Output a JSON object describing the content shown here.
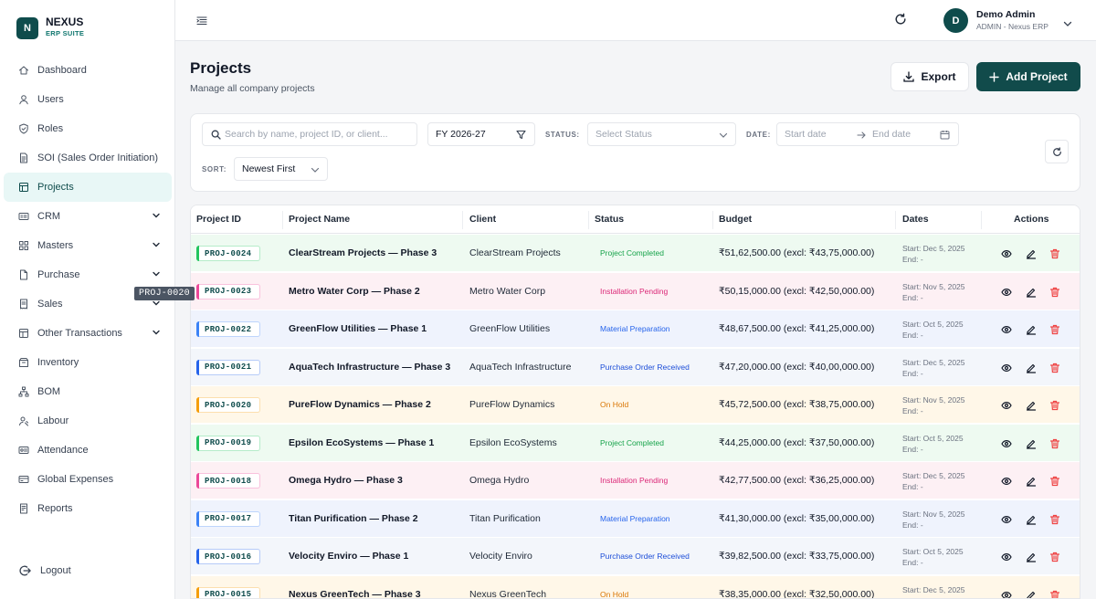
{
  "brand": {
    "logo": "N",
    "name": "NEXUS",
    "sub": "ERP SUITE"
  },
  "sidebar": {
    "items": [
      {
        "label": "Dashboard",
        "icon": "home-icon"
      },
      {
        "label": "Users",
        "icon": "user-icon"
      },
      {
        "label": "Roles",
        "icon": "shield-icon"
      },
      {
        "label": "SOI (Sales Order Initiation)",
        "icon": "document-icon"
      },
      {
        "label": "Projects",
        "icon": "grid-icon",
        "active": true
      },
      {
        "label": "CRM",
        "icon": "crm-icon",
        "expandable": true
      },
      {
        "label": "Masters",
        "icon": "apps-icon",
        "expandable": true
      },
      {
        "label": "Purchase",
        "icon": "file-icon",
        "expandable": true
      },
      {
        "label": "Sales",
        "icon": "receipt-icon",
        "expandable": true
      },
      {
        "label": "Other Transactions",
        "icon": "layout-icon",
        "expandable": true
      },
      {
        "label": "Inventory",
        "icon": "box-icon"
      },
      {
        "label": "BOM",
        "icon": "tree-icon"
      },
      {
        "label": "Labour",
        "icon": "worker-icon"
      },
      {
        "label": "Attendance",
        "icon": "id-card-icon"
      },
      {
        "label": "Global Expenses",
        "icon": "wallet-icon"
      },
      {
        "label": "Reports",
        "icon": "report-icon"
      }
    ],
    "logout": "Logout",
    "tooltip": "PROJ-0020"
  },
  "header": {
    "avatar": "D",
    "user_name": "Demo Admin",
    "user_role": "ADMIN - Nexus ERP"
  },
  "page": {
    "title": "Projects",
    "subtitle": "Manage all company projects",
    "export_label": "Export",
    "add_label": "Add Project"
  },
  "filters": {
    "search_placeholder": "Search by name, project ID, or client...",
    "fy_value": "FY 2026-27",
    "status_label": "STATUS:",
    "status_placeholder": "Select Status",
    "date_label": "DATE:",
    "start_placeholder": "Start date",
    "end_placeholder": "End date",
    "sort_label": "SORT:",
    "sort_value": "Newest First"
  },
  "table": {
    "headers": [
      "Project ID",
      "Project Name",
      "Client",
      "Status",
      "Budget",
      "Dates",
      "Actions"
    ],
    "rows": [
      {
        "id": "PROJ-0024",
        "name": "ClearStream Projects — Phase 3",
        "client": "ClearStream Projects",
        "status": "Project Completed",
        "budget": "₹51,62,500.00 (excl: ₹43,75,000.00)",
        "start": "Start: Dec 5, 2025",
        "end": "End: -"
      },
      {
        "id": "PROJ-0023",
        "name": "Metro Water Corp — Phase 2",
        "client": "Metro Water Corp",
        "status": "Installation Pending",
        "budget": "₹50,15,000.00 (excl: ₹42,50,000.00)",
        "start": "Start: Nov 5, 2025",
        "end": "End: -"
      },
      {
        "id": "PROJ-0022",
        "name": "GreenFlow Utilities — Phase 1",
        "client": "GreenFlow Utilities",
        "status": "Material Preparation",
        "budget": "₹48,67,500.00 (excl: ₹41,25,000.00)",
        "start": "Start: Oct 5, 2025",
        "end": "End: -"
      },
      {
        "id": "PROJ-0021",
        "name": "AquaTech Infrastructure — Phase 3",
        "client": "AquaTech Infrastructure",
        "status": "Purchase Order Received",
        "budget": "₹47,20,000.00 (excl: ₹40,00,000.00)",
        "start": "Start: Dec 5, 2025",
        "end": "End: -"
      },
      {
        "id": "PROJ-0020",
        "name": "PureFlow Dynamics — Phase 2",
        "client": "PureFlow Dynamics",
        "status": "On Hold",
        "budget": "₹45,72,500.00 (excl: ₹38,75,000.00)",
        "start": "Start: Nov 5, 2025",
        "end": "End: -"
      },
      {
        "id": "PROJ-0019",
        "name": "Epsilon EcoSystems — Phase 1",
        "client": "Epsilon EcoSystems",
        "status": "Project Completed",
        "budget": "₹44,25,000.00 (excl: ₹37,50,000.00)",
        "start": "Start: Oct 5, 2025",
        "end": "End: -"
      },
      {
        "id": "PROJ-0018",
        "name": "Omega Hydro — Phase 3",
        "client": "Omega Hydro",
        "status": "Installation Pending",
        "budget": "₹42,77,500.00 (excl: ₹36,25,000.00)",
        "start": "Start: Dec 5, 2025",
        "end": "End: -"
      },
      {
        "id": "PROJ-0017",
        "name": "Titan Purification — Phase 2",
        "client": "Titan Purification",
        "status": "Material Preparation",
        "budget": "₹41,30,000.00 (excl: ₹35,00,000.00)",
        "start": "Start: Nov 5, 2025",
        "end": "End: -"
      },
      {
        "id": "PROJ-0016",
        "name": "Velocity Enviro — Phase 1",
        "client": "Velocity Enviro",
        "status": "Purchase Order Received",
        "budget": "₹39,82,500.00 (excl: ₹33,75,000.00)",
        "start": "Start: Oct 5, 2025",
        "end": "End: -"
      },
      {
        "id": "PROJ-0015",
        "name": "Nexus GreenTech — Phase 3",
        "client": "Nexus GreenTech",
        "status": "On Hold",
        "budget": "₹38,35,000.00 (excl: ₹32,50,000.00)",
        "start": "Start: Dec 5, 2025",
        "end": "End: -"
      }
    ]
  },
  "colors": {
    "brand": "#0f4c4c",
    "completed_bg": "#eefaf1",
    "completed_text": "#16a34a",
    "completed_bar": "#22c55e",
    "installation_bg": "#fdf0f4",
    "installation_text": "#db2777",
    "installation_bar": "#ec4899",
    "material_bg": "#eff3fd",
    "material_text": "#2563eb",
    "material_bar": "#3b82f6",
    "purchase_bg": "#f3f6fb",
    "purchase_text": "#1d4ed8",
    "purchase_bar": "#2563eb",
    "hold_bg": "#fff7e8",
    "hold_text": "#d97706",
    "hold_bar": "#f59e0b",
    "delete": "#ef4444"
  }
}
